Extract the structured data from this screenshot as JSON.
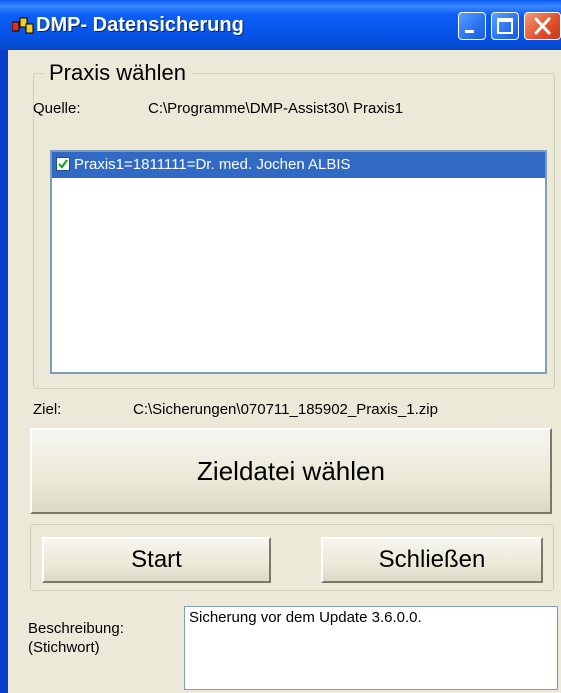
{
  "window": {
    "title": "DMP- Datensicherung",
    "colors": {
      "titlebar": "#0654e8",
      "client": "#ece9d8",
      "selection": "#316ac5",
      "close": "#e0502a"
    }
  },
  "praxis": {
    "legend": "Praxis wählen",
    "source_label": "Quelle:",
    "source_path": "C:\\Programme\\DMP-Assist30\\ Praxis1",
    "items": [
      {
        "label": "Praxis1=1811111=Dr. med. Jochen ALBIS",
        "checked": true,
        "selected": true
      }
    ]
  },
  "target": {
    "label": "Ziel:",
    "path": "C:\\Sicherungen\\070711_185902_Praxis_1.zip",
    "choose_button": "Zieldatei wählen"
  },
  "actions": {
    "start_button": "Start",
    "close_button": "Schließen"
  },
  "description": {
    "label_line1": "Beschreibung:",
    "label_line2": "(Stichwort)",
    "value": "Sicherung vor dem Update 3.6.0.0."
  },
  "icons": [
    "app-icon",
    "minimize-icon",
    "maximize-icon",
    "close-icon",
    "checkmark-icon"
  ]
}
